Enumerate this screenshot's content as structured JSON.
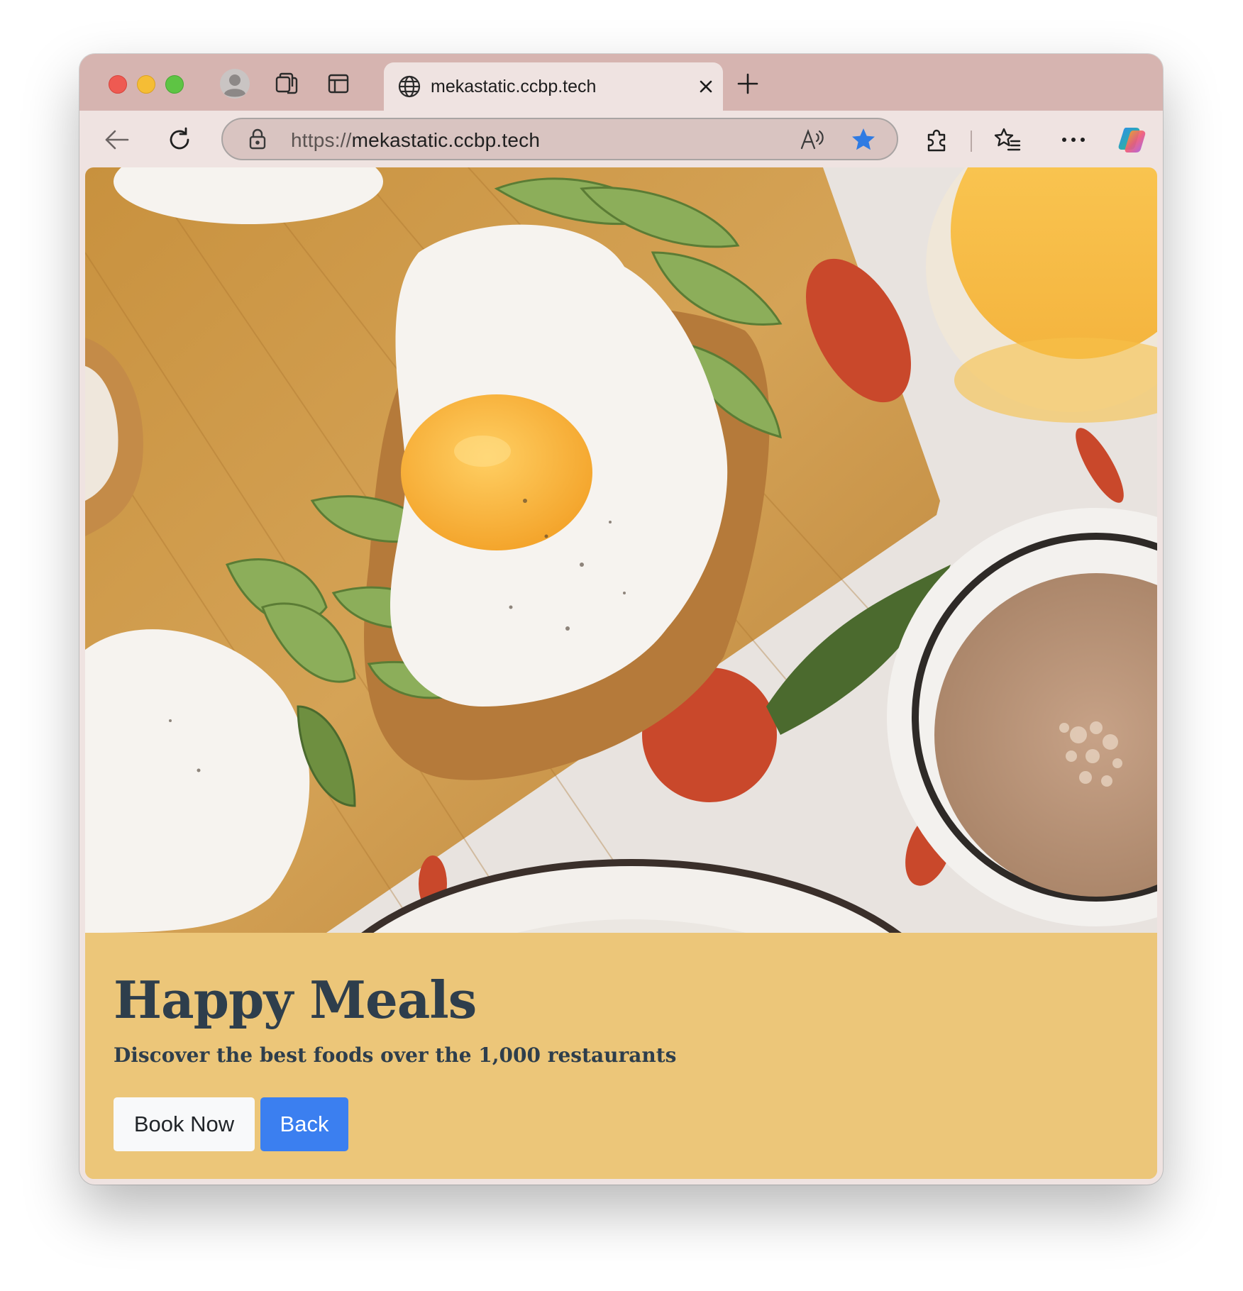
{
  "browser": {
    "tab": {
      "title": "mekastatic.ccbp.tech"
    },
    "address_bar": {
      "scheme": "https://",
      "host": "mekastatic.ccbp.tech"
    },
    "favorite_star_color": "#2f7be3"
  },
  "page": {
    "hero_image_alt": "",
    "heading": "Happy Meals",
    "subheading": "Discover the best foods over the 1,000 restaurants",
    "buttons": {
      "book_now": "Book Now",
      "back": "Back"
    },
    "colors": {
      "banner_bg": "#ecc679",
      "heading": "#2e3e4c",
      "primary_button": "#3b7ff0",
      "light_button": "#f8f9fa"
    }
  }
}
